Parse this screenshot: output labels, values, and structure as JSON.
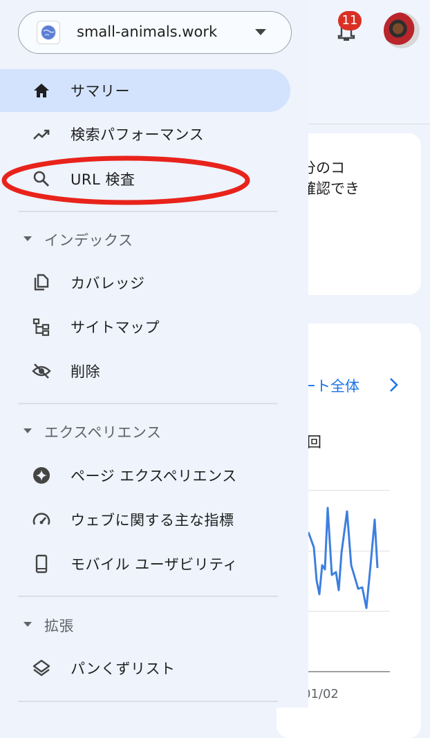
{
  "property": {
    "name": "small-animals.work",
    "icon": "globe-icon"
  },
  "notifications": {
    "count": "11",
    "icon": "bell-icon"
  },
  "nav": {
    "summary": "サマリー",
    "performance": "検索パフォーマンス",
    "url_inspection": "URL 検査"
  },
  "sections": {
    "index": {
      "title": "インデックス",
      "items": [
        "カバレッジ",
        "サイトマップ",
        "削除"
      ]
    },
    "experience": {
      "title": "エクスペリエンス",
      "items": [
        "ページ エクスペリエンス",
        "ウェブに関する主な指標",
        "モバイル ユーザビリティ"
      ]
    },
    "enhancements": {
      "title": "拡張",
      "items": [
        "パンくずリスト"
      ]
    }
  },
  "background": {
    "card1_line1": "分のコ",
    "card1_line2": "確認でき",
    "report_link": "ート全体",
    "count_text": "回",
    "x_tick": "01/02"
  },
  "colors": {
    "accent": "#1a73e8",
    "active_bg": "#d3e3fd",
    "annotation_ring": "#e8231b",
    "badge": "#d93025"
  }
}
